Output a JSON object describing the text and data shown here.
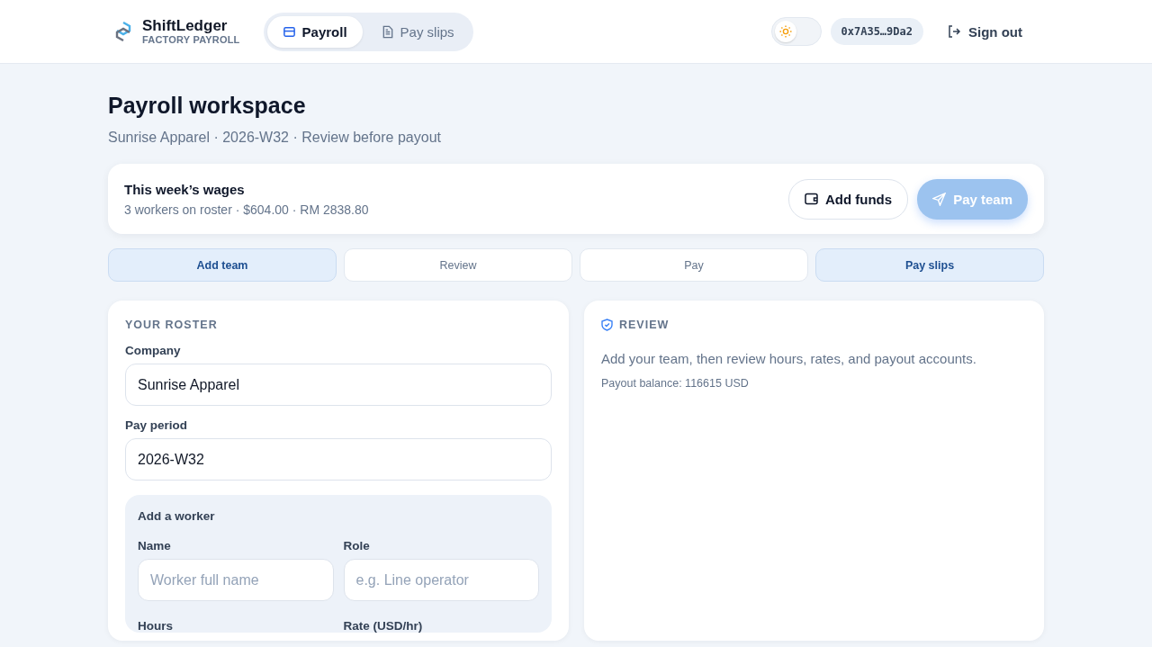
{
  "brand": {
    "name": "ShiftLedger",
    "tagline": "FACTORY PAYROLL"
  },
  "nav_tabs": [
    {
      "label": "Payroll",
      "selected": true
    },
    {
      "label": "Pay slips",
      "selected": false
    }
  ],
  "theme_toggle": {
    "on": false
  },
  "wallet": "0x7A35…9Da2",
  "sign_out": "Sign out",
  "page": {
    "title": "Payroll workspace",
    "subtitle": "Sunrise Apparel · 2026-W32 · Review before payout"
  },
  "summary": {
    "title": "This week’s wages",
    "detail": "3 workers on roster · $604.00 · RM 2838.80",
    "add_funds": "Add funds",
    "pay_team": {
      "label": "Pay team",
      "disabled": true
    }
  },
  "steps": [
    {
      "label": "Add team",
      "highlighted": true
    },
    {
      "label": "Review",
      "highlighted": false
    },
    {
      "label": "Pay",
      "highlighted": false
    },
    {
      "label": "Pay slips",
      "highlighted": true
    }
  ],
  "roster": {
    "heading": "YOUR ROSTER",
    "fields": [
      {
        "label": "Company",
        "value": "Sunrise Apparel"
      },
      {
        "label": "Pay period",
        "value": "2026-W32"
      }
    ],
    "add_worker": {
      "title": "Add a worker",
      "fields": [
        {
          "label": "Name",
          "placeholder": "Worker full name"
        },
        {
          "label": "Role",
          "placeholder": "e.g. Line operator"
        }
      ],
      "next_labels": [
        "Hours",
        "Rate (USD/hr)"
      ]
    }
  },
  "review": {
    "heading": "REVIEW",
    "text": "Add your team, then review hours, rates, and payout accounts.",
    "balance": "Payout balance: 116615 USD"
  }
}
